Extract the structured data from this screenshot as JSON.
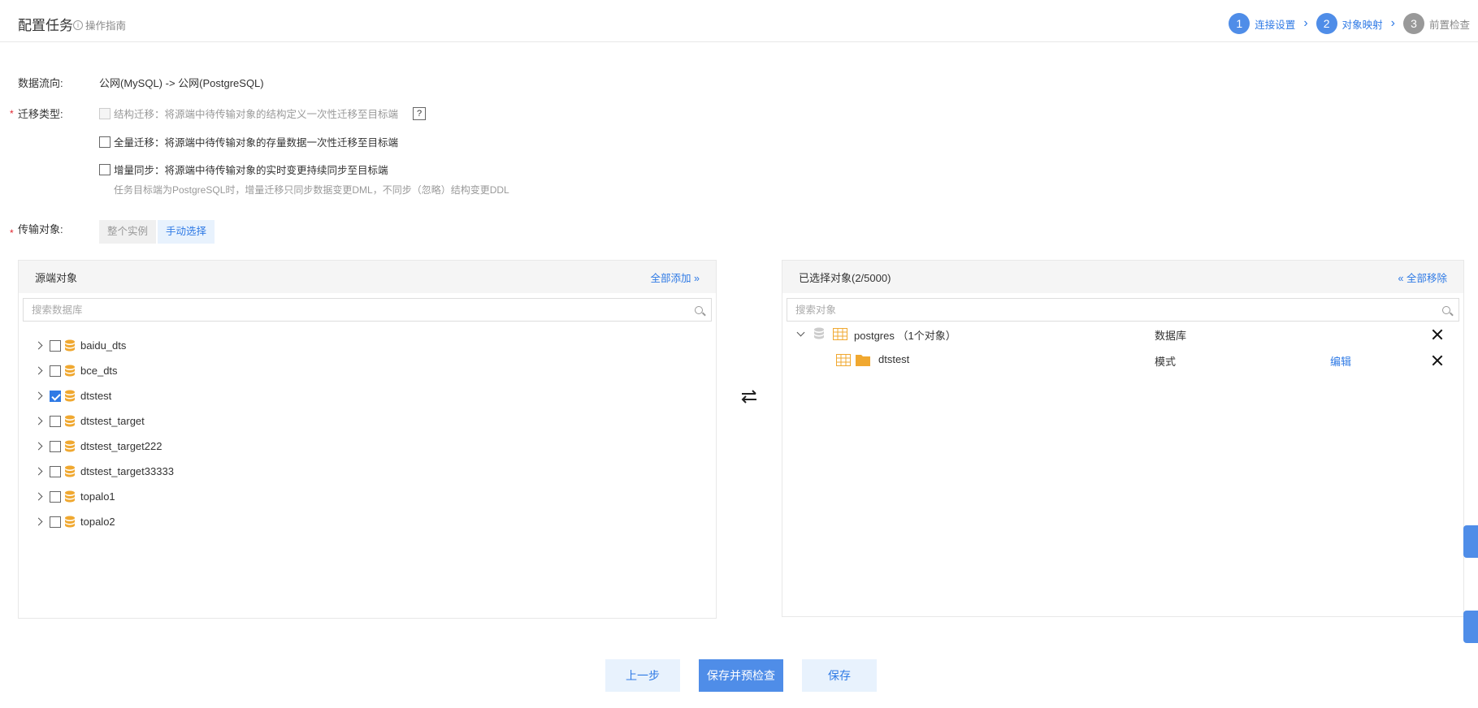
{
  "header": {
    "title": "配置任务",
    "guide": "操作指南",
    "steps": [
      {
        "num": "1",
        "label": "连接设置"
      },
      {
        "num": "2",
        "label": "对象映射"
      },
      {
        "num": "3",
        "label": "前置检查"
      }
    ]
  },
  "form": {
    "flow_label": "数据流向:",
    "flow_value": "公网(MySQL) -> 公网(PostgreSQL)",
    "migrate_label": "迁移类型:",
    "options": [
      {
        "label": "结构迁移：将源端中待传输对象的结构定义一次性迁移至目标端",
        "checked": false,
        "disabled": true
      },
      {
        "label": "全量迁移：将源端中待传输对象的存量数据一次性迁移至目标端",
        "checked": false,
        "disabled": false
      },
      {
        "label": "增量同步：将源端中待传输对象的实时变更持续同步至目标端",
        "checked": false,
        "disabled": false
      }
    ],
    "help": "?",
    "hint": "任务目标端为PostgreSQL时，增量迁移只同步数据变更DML，不同步（忽略）结构变更DDL",
    "object_label": "传输对象:",
    "object_modes": [
      "整个实例",
      "手动选择"
    ],
    "object_mode_selected": "手动选择"
  },
  "left_panel": {
    "title": "源端对象",
    "action": "全部添加",
    "search_placeholder": "搜索数据库",
    "items": [
      {
        "name": "baidu_dts",
        "checked": false
      },
      {
        "name": "bce_dts",
        "checked": false
      },
      {
        "name": "dtstest",
        "checked": true
      },
      {
        "name": "dtstest_target",
        "checked": false
      },
      {
        "name": "dtstest_target222",
        "checked": false
      },
      {
        "name": "dtstest_target33333",
        "checked": false
      },
      {
        "name": "topalo1",
        "checked": false
      },
      {
        "name": "topalo2",
        "checked": false
      }
    ]
  },
  "right_panel": {
    "title": "已选择对象(2/5000)",
    "action": "全部移除",
    "search_placeholder": "搜索对象",
    "rows": [
      {
        "name": "postgres （1个对象）",
        "type": "数据库",
        "edit": ""
      },
      {
        "name": "dtstest",
        "type": "模式",
        "edit": "编辑"
      }
    ]
  },
  "buttons": {
    "prev": "上一步",
    "save_check": "保存并预检查",
    "save": "保存"
  },
  "colors": {
    "accent": "#2f7ae5",
    "primary_button": "#4f8de8",
    "db_icon": "#f0a830",
    "required": "#e0242e"
  }
}
